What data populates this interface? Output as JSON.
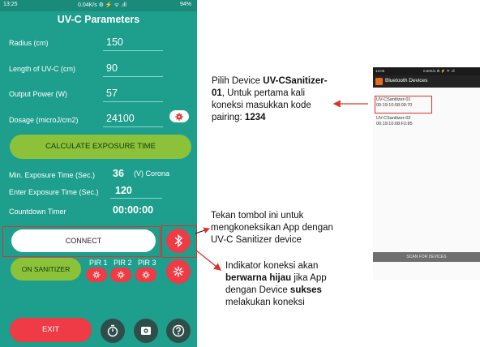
{
  "status_bar": {
    "time": "13:25",
    "indicators": "0.04K/s ⚙ ⚡ ᯤ .ıll",
    "battery": "94%"
  },
  "app": {
    "title": "UV-C Parameters",
    "fields": [
      {
        "label": "Radius (cm)",
        "value": "150"
      },
      {
        "label": "Length of UV-C (cm)",
        "value": "90"
      },
      {
        "label": "Output Power (W)",
        "value": "57"
      },
      {
        "label": "Dosage (microJ/cm2)",
        "value": "24100"
      }
    ],
    "calculate_button": "CALCULATE EXPOSURE TIME",
    "min_exposure": {
      "label": "Min. Exposure Time (Sec.)",
      "value": "36",
      "note": "(V) Corona"
    },
    "enter_exposure": {
      "label": "Enter Exposure Time (Sec.)",
      "value": "120"
    },
    "countdown": {
      "label": "Countdown Timer",
      "value": "00:00:00"
    },
    "connect_button": "CONNECT",
    "on_sanitizer_button": "ON SANITIZER",
    "pir_labels": [
      "PIR 1",
      "PIR 2",
      "PIR 3"
    ],
    "exit_button": "EXIT",
    "colors": {
      "background": "#1e9e8d",
      "accent_green": "#8bc23a",
      "accent_red": "#ee3b45"
    },
    "icons": {
      "dosage": "settings-icon",
      "bluetooth": "bluetooth-icon",
      "timer": "timer-icon",
      "camera": "camera-icon",
      "help": "help-icon"
    }
  },
  "annotations": {
    "device_select": {
      "line1_pre": "Pilih Device ",
      "line1_bold": "UV-CSanitizer-",
      "line2_bold": "01",
      "line2_post": ", Untuk pertama kali",
      "line3": "koneksi masukkan kode",
      "line4_pre": "pairing: ",
      "line4_bold": "1234"
    },
    "connect": {
      "line1": "Tekan tombol ini untuk",
      "line2": "mengkoneksikan App dengan",
      "line3": "UV-C Sanitizer device"
    },
    "indicator": {
      "line1": "Indikator koneksi akan",
      "line2_bold": "berwarna hijau",
      "line2_post": " jika App",
      "line3_pre": "dengan Device ",
      "line3_bold": "sukses",
      "line4": "melakukan koneksi"
    }
  },
  "bluetooth_screen": {
    "status_time": "13:05",
    "status_info": "0.60K/s ⚙ ⚡ ᯤ .ıll",
    "title": "Bluetooth Devices",
    "devices": [
      {
        "name": "UV-CSanitizer-01",
        "address": "00:19:10:08:09:70"
      },
      {
        "name": "UV-CSanitizer-02",
        "address": "00:19:10:08:F2:85"
      }
    ],
    "scan_button": "SCAN FOR DEVICES"
  }
}
